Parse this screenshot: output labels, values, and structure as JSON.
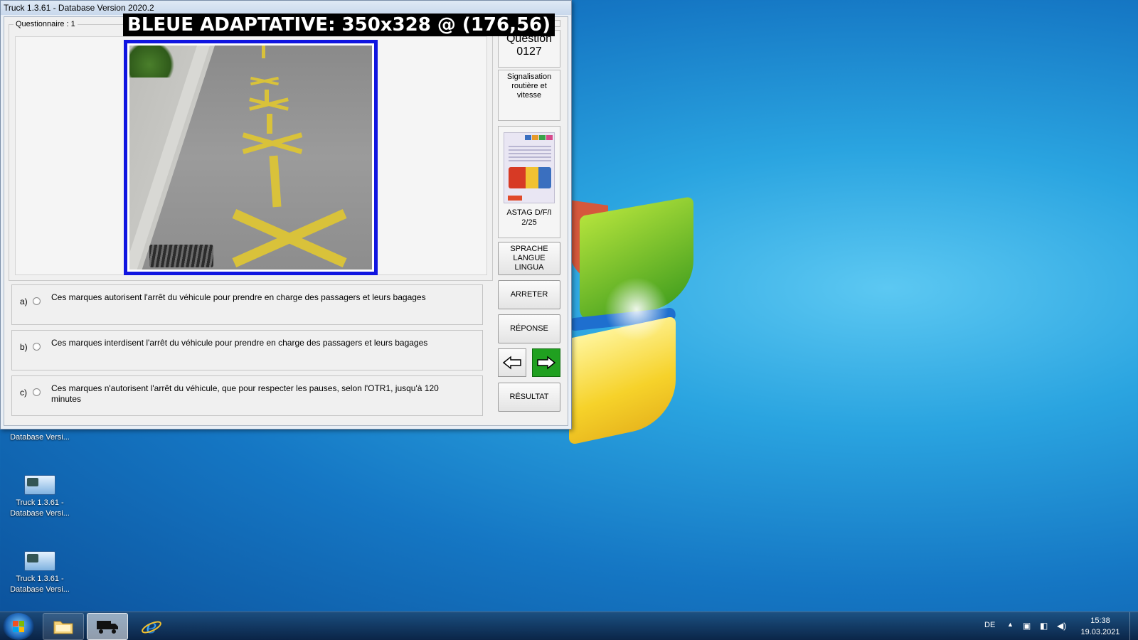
{
  "window": {
    "title": "Truck 1.3.61 - Database Version 2020.2",
    "group_label": "Questionnaire : 1"
  },
  "overlay": {
    "text": "BLEUE ADAPTATIVE: 350x328 @ (176,56)"
  },
  "question": {
    "title": "Question",
    "number": "0127",
    "category": "Signalisation routière et vitesse"
  },
  "book": {
    "name": "ASTAG D/F/I",
    "page": "2/25",
    "cover_text": "L'instruction pour le permis de conduire des catégories C, CE et D",
    "cover_chips": [
      "C",
      "CE",
      "D",
      "DE"
    ],
    "cover_brand": "ASTAG"
  },
  "answers": [
    {
      "letter": "a)",
      "text": "Ces marques autorisent l'arrêt du véhicule pour prendre en charge des passagers et leurs bagages"
    },
    {
      "letter": "b)",
      "text": "Ces marques interdisent l'arrêt du véhicule pour prendre en charge des passagers et leurs bagages"
    },
    {
      "letter": "c)",
      "text": "Ces marques n'autorisent l'arrêt du véhicule, que pour respecter les pauses, selon l'OTR1, jusqu'à 120 minutes"
    }
  ],
  "buttons": {
    "language_lines": [
      "SPRACHE",
      "LANGUE",
      "LINGUA"
    ],
    "stop": "ARRETER",
    "answer": "RÉPONSE",
    "result": "RÉSULTAT"
  },
  "desktop_icons": [
    {
      "label": "Database Versi..."
    },
    {
      "label": "Truck 1.3.61 - Database Versi..."
    },
    {
      "label": "Truck 1.3.61 - Database Versi..."
    }
  ],
  "taskbar": {
    "language": "DE",
    "time": "15:38",
    "date": "19.03.2021",
    "tray_icons": [
      "up-arrow-icon",
      "usb-icon",
      "network-icon",
      "volume-icon"
    ]
  },
  "colors": {
    "photo_frame": "#1015e0",
    "next_button": "#20a020",
    "overlay_bg": "#000000"
  }
}
